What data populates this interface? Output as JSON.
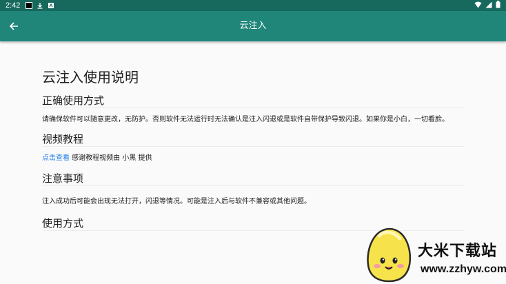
{
  "status_bar": {
    "time": "2:42"
  },
  "app_bar": {
    "title": "云注入"
  },
  "doc": {
    "title": "云注入使用说明",
    "sections": [
      {
        "heading": "正确使用方式",
        "body": "请确保软件可以随意更改，无防护。否则软件无法运行时无法确认是注入闪退或是软件自带保护导致闪退。如果你是小白，一切看脸。"
      },
      {
        "heading": "视频教程",
        "link": "点击查看",
        "body": " 感谢教程视频由 小黑 提供"
      },
      {
        "heading": "注意事项",
        "body": "注入成功后可能会出现无法打开，闪退等情况。可能是注入后与软件不兼容或其他问题。"
      },
      {
        "heading": "使用方式"
      }
    ]
  },
  "watermark": {
    "text": "大米下载站",
    "url": "www.zzhyw.com"
  },
  "colors": {
    "status_bar": "#17695e",
    "app_bar": "#20867a",
    "link": "#1f7de2"
  }
}
